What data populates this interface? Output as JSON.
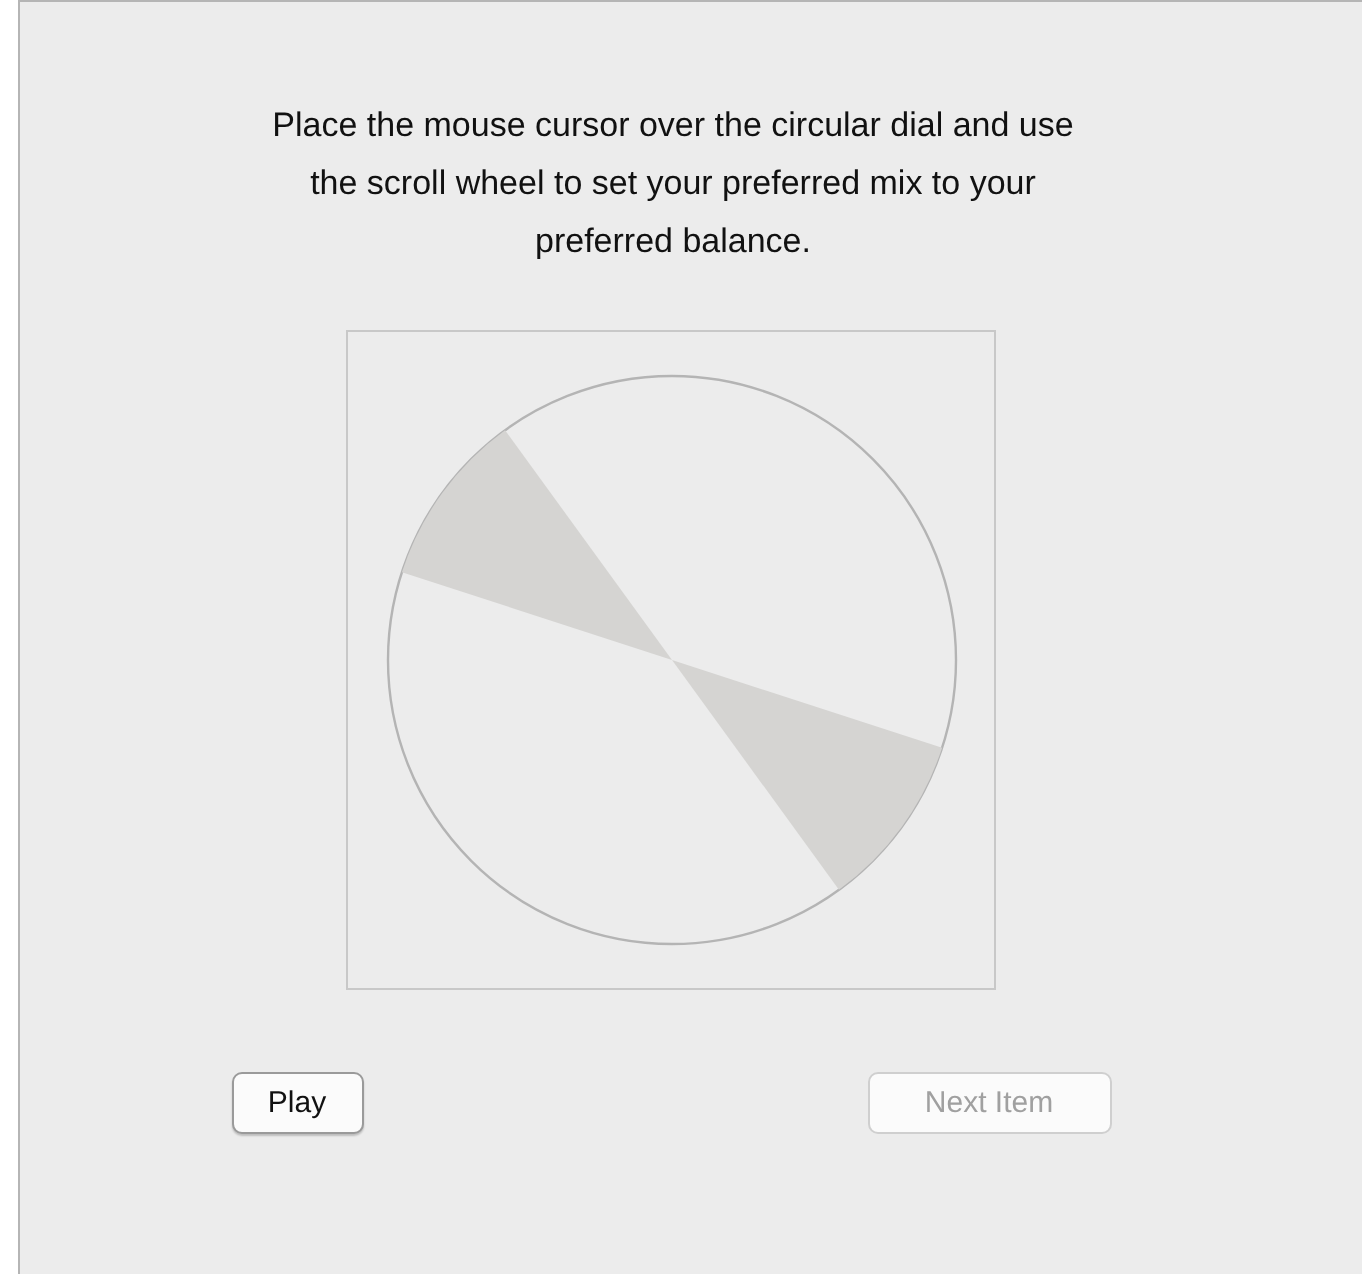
{
  "instructions": "Place the mouse cursor over the circular dial and use the scroll wheel to set your preferred mix to your preferred balance.",
  "buttons": [
    {
      "label": "Play",
      "disabled": false
    },
    {
      "label": "Next Item",
      "disabled": true
    }
  ]
}
